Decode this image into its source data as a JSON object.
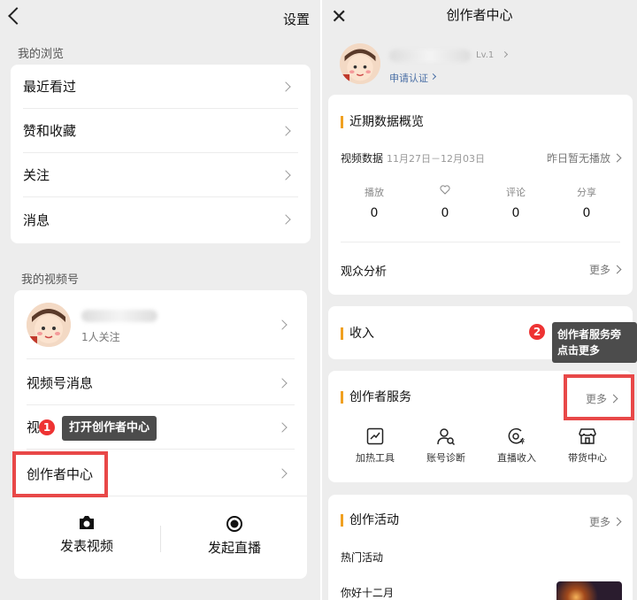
{
  "left": {
    "settings_label": "设置",
    "browse_section": "我的浏览",
    "browse_items": [
      "最近看过",
      "赞和收藏",
      "关注",
      "消息"
    ],
    "channel_section": "我的视频号",
    "profile_followers": "1人关注",
    "channel_items": [
      "视频号消息",
      "视",
      "创作者中心"
    ],
    "post_video": "发表视频",
    "start_live": "发起直播",
    "step1_badge": "1",
    "step1_tip": "打开创作者中心"
  },
  "right": {
    "title": "创作者中心",
    "level": "Lv.1",
    "apply_cert": "申请认证",
    "overview_title": "近期数据概览",
    "video_data_label": "视频数据",
    "date_range": "11月27日－12月03日",
    "yesterday_note": "昨日暂无播放",
    "stats": [
      {
        "label": "播放",
        "value": "0"
      },
      {
        "label": "",
        "value": "0"
      },
      {
        "label": "评论",
        "value": "0"
      },
      {
        "label": "分享",
        "value": "0"
      }
    ],
    "audience_label": "观众分析",
    "more": "更多",
    "income_title": "收入",
    "step2_badge": "2",
    "step2_tip_line1": "创作者服务旁",
    "step2_tip_line2": "点击更多",
    "services_title": "创作者服务",
    "services": [
      "加热工具",
      "账号诊断",
      "直播收入",
      "带货中心"
    ],
    "activity_title": "创作活动",
    "hot_activity": "热门活动",
    "activity_item": "你好十二月"
  }
}
